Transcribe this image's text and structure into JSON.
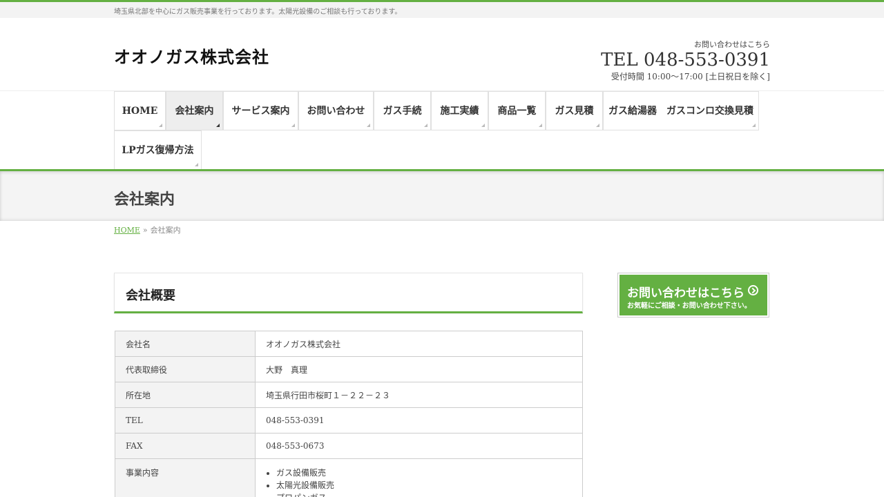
{
  "topbar": {
    "description": "埼玉県北部を中心にガス販売事業を行っております。太陽光設備のご相談も行っております。"
  },
  "header": {
    "logo_text": "オオノガス株式会社",
    "contact_label": "お問い合わせはこちら",
    "tel": "TEL 048-553-0391",
    "hours": "受付時間 10:00～17:00 [土日祝日を除く]"
  },
  "nav": {
    "items": [
      {
        "label": "HOME"
      },
      {
        "label": "会社案内"
      },
      {
        "label": "サービス案内"
      },
      {
        "label": "お問い合わせ"
      },
      {
        "label": "ガス手続"
      },
      {
        "label": "施工実績"
      },
      {
        "label": "商品一覧"
      },
      {
        "label": "ガス見積"
      },
      {
        "label": "ガス給湯器　ガスコンロ交換見積"
      },
      {
        "label": "LPガス復帰方法"
      }
    ],
    "active_index": 1
  },
  "page": {
    "title": "会社案内",
    "breadcrumb_home": "HOME",
    "breadcrumb_sep": "»",
    "breadcrumb_current": "会社案内"
  },
  "section": {
    "title": "会社概要"
  },
  "table": {
    "rows": [
      {
        "key": "会社名",
        "value": "オオノガス株式会社"
      },
      {
        "key": "代表取締役",
        "value": "大野　真理"
      },
      {
        "key": "所在地",
        "value": "埼玉県行田市桜町１－２２－２３"
      },
      {
        "key": "TEL",
        "value": "048-553-0391"
      },
      {
        "key": "FAX",
        "value": "048-553-0673"
      },
      {
        "key": "事業内容",
        "list": [
          "ガス設備販売",
          "太陽光設備販売",
          "プロパンガス"
        ]
      }
    ]
  },
  "sidebar": {
    "banner_line1": "お問い合わせはこちら",
    "banner_line2": "お気軽にご相談・お問い合わせ下さい。"
  },
  "colors": {
    "accent": "#64b042",
    "nav_active_bg": "#eeeeee",
    "title_bar_bg": "#f4f4f4"
  }
}
